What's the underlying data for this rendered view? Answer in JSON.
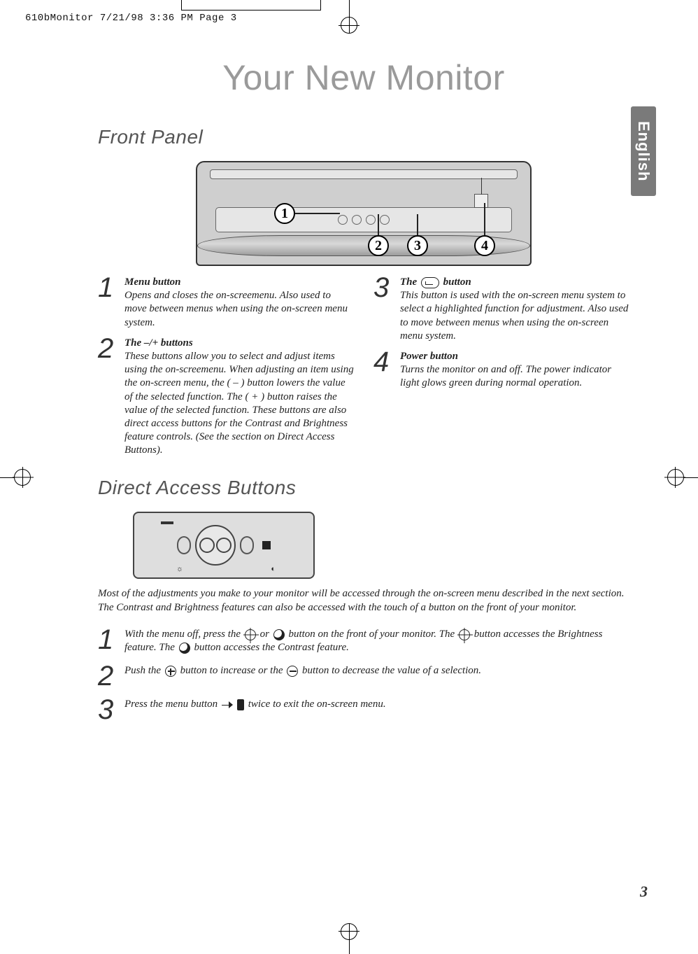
{
  "print_header": "610bMonitor  7/21/98 3:36 PM  Page 3",
  "title": "Your New Monitor",
  "language_tab": "English",
  "sections": {
    "front_panel": "Front Panel",
    "direct_access": "Direct Access Buttons"
  },
  "callouts": {
    "c1": "1",
    "c2": "2",
    "c3": "3",
    "c4": "4"
  },
  "front_items": [
    {
      "num": "1",
      "heading": "Menu button",
      "text": "Opens and closes the on-screemenu. Also used to move between menus when using the on-screen menu system."
    },
    {
      "num": "2",
      "heading": "The –/+ buttons",
      "text": "These buttons allow you to select and adjust items using the on-screemenu. When adjusting an item using the on-screen menu, the ( – ) button lowers the value of the selected function. The ( + ) button raises the value of the selected function. These buttons are also direct access buttons for the Contrast and Brightness feature controls. (See the section on Direct Access Buttons)."
    },
    {
      "num": "3",
      "heading_pre": "The ",
      "heading_post": " button",
      "text": "This button is used with the on-screen menu system to select a highlighted function for adjustment. Also used to move between menus when using the on-screen menu system."
    },
    {
      "num": "4",
      "heading": "Power button",
      "text": "Turns the monitor on and off. The power indicator light glows green during normal operation."
    }
  ],
  "direct_access_intro": "Most of the adjustments you make to your monitor will be accessed through the on-screen menu described in the next section. The Contrast and Brightness features can also be accessed with the touch of a button on the front of your monitor.",
  "steps": {
    "s1": {
      "num": "1",
      "pre": "With the menu off, press the ",
      "mid1": " or ",
      "mid2": " button on the front of your monitor.  The ",
      "mid3": " button accesses the Brightness feature.  The ",
      "post": " button accesses the Contrast feature."
    },
    "s2": {
      "num": "2",
      "pre": "Push the  ",
      "mid": " button to increase or the ",
      "post": " button to decrease the value of a selection."
    },
    "s3": {
      "num": "3",
      "pre": "Press the menu button  ",
      "post": "  twice to exit the on-screen menu."
    }
  },
  "page_number": "3"
}
